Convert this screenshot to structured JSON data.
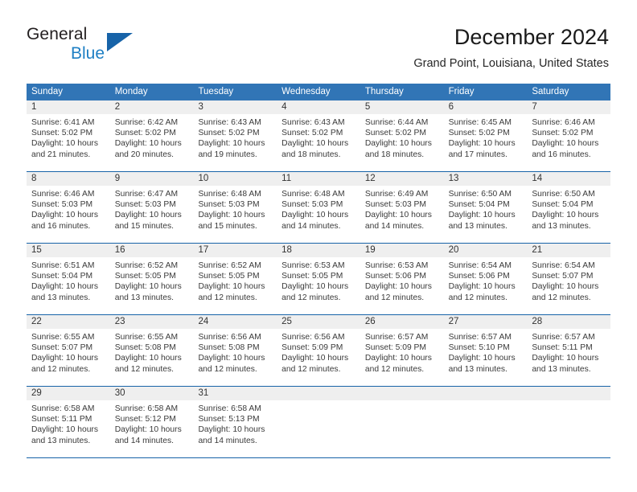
{
  "brand": {
    "line1": "General",
    "line2": "Blue",
    "flag_color": "#1763a8"
  },
  "header": {
    "title": "December 2024",
    "subtitle": "Grand Point, Louisiana, United States"
  },
  "theme": {
    "header_blue": "#3175b6",
    "rule_blue": "#1763a8",
    "daynum_bg": "#efefef"
  },
  "weekdays": [
    "Sunday",
    "Monday",
    "Tuesday",
    "Wednesday",
    "Thursday",
    "Friday",
    "Saturday"
  ],
  "weeks": [
    [
      {
        "day": "1",
        "sunrise": "Sunrise: 6:41 AM",
        "sunset": "Sunset: 5:02 PM",
        "daylight1": "Daylight: 10 hours",
        "daylight2": "and 21 minutes."
      },
      {
        "day": "2",
        "sunrise": "Sunrise: 6:42 AM",
        "sunset": "Sunset: 5:02 PM",
        "daylight1": "Daylight: 10 hours",
        "daylight2": "and 20 minutes."
      },
      {
        "day": "3",
        "sunrise": "Sunrise: 6:43 AM",
        "sunset": "Sunset: 5:02 PM",
        "daylight1": "Daylight: 10 hours",
        "daylight2": "and 19 minutes."
      },
      {
        "day": "4",
        "sunrise": "Sunrise: 6:43 AM",
        "sunset": "Sunset: 5:02 PM",
        "daylight1": "Daylight: 10 hours",
        "daylight2": "and 18 minutes."
      },
      {
        "day": "5",
        "sunrise": "Sunrise: 6:44 AM",
        "sunset": "Sunset: 5:02 PM",
        "daylight1": "Daylight: 10 hours",
        "daylight2": "and 18 minutes."
      },
      {
        "day": "6",
        "sunrise": "Sunrise: 6:45 AM",
        "sunset": "Sunset: 5:02 PM",
        "daylight1": "Daylight: 10 hours",
        "daylight2": "and 17 minutes."
      },
      {
        "day": "7",
        "sunrise": "Sunrise: 6:46 AM",
        "sunset": "Sunset: 5:02 PM",
        "daylight1": "Daylight: 10 hours",
        "daylight2": "and 16 minutes."
      }
    ],
    [
      {
        "day": "8",
        "sunrise": "Sunrise: 6:46 AM",
        "sunset": "Sunset: 5:03 PM",
        "daylight1": "Daylight: 10 hours",
        "daylight2": "and 16 minutes."
      },
      {
        "day": "9",
        "sunrise": "Sunrise: 6:47 AM",
        "sunset": "Sunset: 5:03 PM",
        "daylight1": "Daylight: 10 hours",
        "daylight2": "and 15 minutes."
      },
      {
        "day": "10",
        "sunrise": "Sunrise: 6:48 AM",
        "sunset": "Sunset: 5:03 PM",
        "daylight1": "Daylight: 10 hours",
        "daylight2": "and 15 minutes."
      },
      {
        "day": "11",
        "sunrise": "Sunrise: 6:48 AM",
        "sunset": "Sunset: 5:03 PM",
        "daylight1": "Daylight: 10 hours",
        "daylight2": "and 14 minutes."
      },
      {
        "day": "12",
        "sunrise": "Sunrise: 6:49 AM",
        "sunset": "Sunset: 5:03 PM",
        "daylight1": "Daylight: 10 hours",
        "daylight2": "and 14 minutes."
      },
      {
        "day": "13",
        "sunrise": "Sunrise: 6:50 AM",
        "sunset": "Sunset: 5:04 PM",
        "daylight1": "Daylight: 10 hours",
        "daylight2": "and 13 minutes."
      },
      {
        "day": "14",
        "sunrise": "Sunrise: 6:50 AM",
        "sunset": "Sunset: 5:04 PM",
        "daylight1": "Daylight: 10 hours",
        "daylight2": "and 13 minutes."
      }
    ],
    [
      {
        "day": "15",
        "sunrise": "Sunrise: 6:51 AM",
        "sunset": "Sunset: 5:04 PM",
        "daylight1": "Daylight: 10 hours",
        "daylight2": "and 13 minutes."
      },
      {
        "day": "16",
        "sunrise": "Sunrise: 6:52 AM",
        "sunset": "Sunset: 5:05 PM",
        "daylight1": "Daylight: 10 hours",
        "daylight2": "and 13 minutes."
      },
      {
        "day": "17",
        "sunrise": "Sunrise: 6:52 AM",
        "sunset": "Sunset: 5:05 PM",
        "daylight1": "Daylight: 10 hours",
        "daylight2": "and 12 minutes."
      },
      {
        "day": "18",
        "sunrise": "Sunrise: 6:53 AM",
        "sunset": "Sunset: 5:05 PM",
        "daylight1": "Daylight: 10 hours",
        "daylight2": "and 12 minutes."
      },
      {
        "day": "19",
        "sunrise": "Sunrise: 6:53 AM",
        "sunset": "Sunset: 5:06 PM",
        "daylight1": "Daylight: 10 hours",
        "daylight2": "and 12 minutes."
      },
      {
        "day": "20",
        "sunrise": "Sunrise: 6:54 AM",
        "sunset": "Sunset: 5:06 PM",
        "daylight1": "Daylight: 10 hours",
        "daylight2": "and 12 minutes."
      },
      {
        "day": "21",
        "sunrise": "Sunrise: 6:54 AM",
        "sunset": "Sunset: 5:07 PM",
        "daylight1": "Daylight: 10 hours",
        "daylight2": "and 12 minutes."
      }
    ],
    [
      {
        "day": "22",
        "sunrise": "Sunrise: 6:55 AM",
        "sunset": "Sunset: 5:07 PM",
        "daylight1": "Daylight: 10 hours",
        "daylight2": "and 12 minutes."
      },
      {
        "day": "23",
        "sunrise": "Sunrise: 6:55 AM",
        "sunset": "Sunset: 5:08 PM",
        "daylight1": "Daylight: 10 hours",
        "daylight2": "and 12 minutes."
      },
      {
        "day": "24",
        "sunrise": "Sunrise: 6:56 AM",
        "sunset": "Sunset: 5:08 PM",
        "daylight1": "Daylight: 10 hours",
        "daylight2": "and 12 minutes."
      },
      {
        "day": "25",
        "sunrise": "Sunrise: 6:56 AM",
        "sunset": "Sunset: 5:09 PM",
        "daylight1": "Daylight: 10 hours",
        "daylight2": "and 12 minutes."
      },
      {
        "day": "26",
        "sunrise": "Sunrise: 6:57 AM",
        "sunset": "Sunset: 5:09 PM",
        "daylight1": "Daylight: 10 hours",
        "daylight2": "and 12 minutes."
      },
      {
        "day": "27",
        "sunrise": "Sunrise: 6:57 AM",
        "sunset": "Sunset: 5:10 PM",
        "daylight1": "Daylight: 10 hours",
        "daylight2": "and 13 minutes."
      },
      {
        "day": "28",
        "sunrise": "Sunrise: 6:57 AM",
        "sunset": "Sunset: 5:11 PM",
        "daylight1": "Daylight: 10 hours",
        "daylight2": "and 13 minutes."
      }
    ],
    [
      {
        "day": "29",
        "sunrise": "Sunrise: 6:58 AM",
        "sunset": "Sunset: 5:11 PM",
        "daylight1": "Daylight: 10 hours",
        "daylight2": "and 13 minutes."
      },
      {
        "day": "30",
        "sunrise": "Sunrise: 6:58 AM",
        "sunset": "Sunset: 5:12 PM",
        "daylight1": "Daylight: 10 hours",
        "daylight2": "and 14 minutes."
      },
      {
        "day": "31",
        "sunrise": "Sunrise: 6:58 AM",
        "sunset": "Sunset: 5:13 PM",
        "daylight1": "Daylight: 10 hours",
        "daylight2": "and 14 minutes."
      },
      {
        "day": "",
        "sunrise": "",
        "sunset": "",
        "daylight1": "",
        "daylight2": ""
      },
      {
        "day": "",
        "sunrise": "",
        "sunset": "",
        "daylight1": "",
        "daylight2": ""
      },
      {
        "day": "",
        "sunrise": "",
        "sunset": "",
        "daylight1": "",
        "daylight2": ""
      },
      {
        "day": "",
        "sunrise": "",
        "sunset": "",
        "daylight1": "",
        "daylight2": ""
      }
    ]
  ]
}
